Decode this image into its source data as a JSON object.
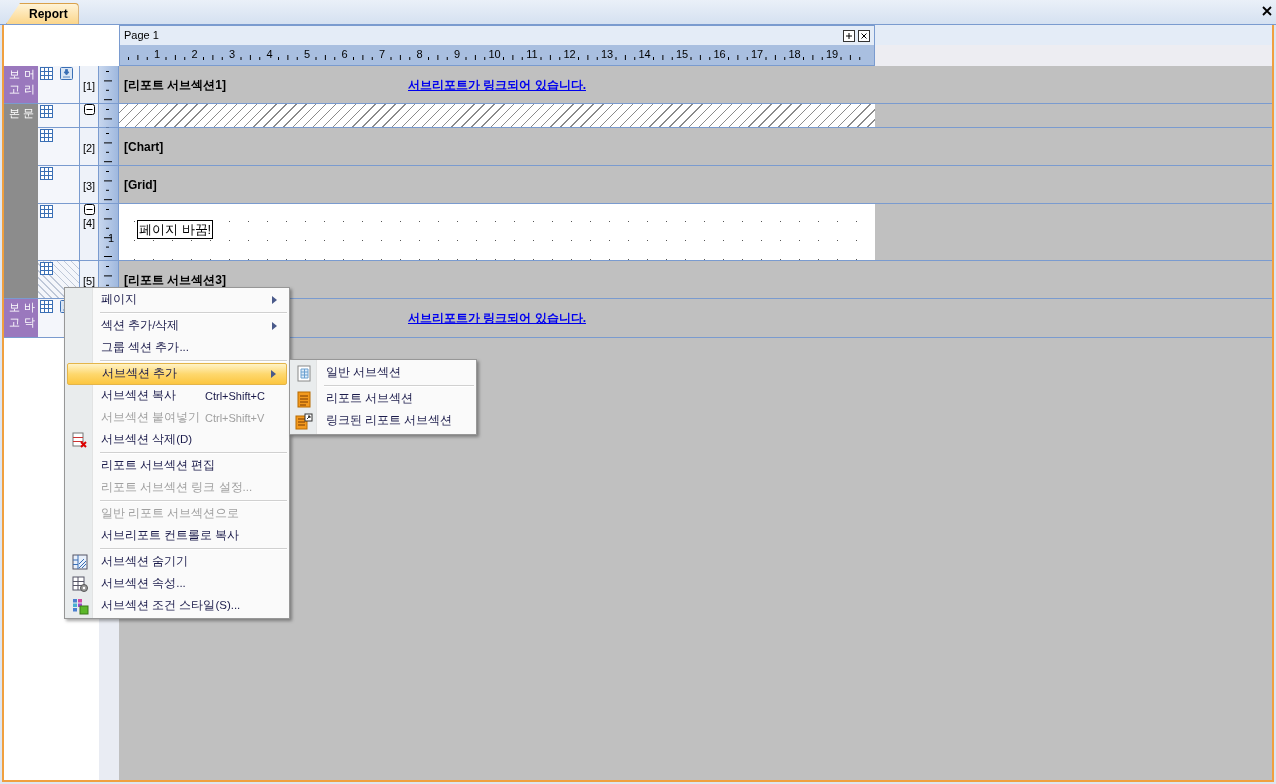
{
  "window": {
    "title": "Report"
  },
  "page": {
    "title": "Page 1",
    "ruler": [
      "1",
      "2",
      "3",
      "4",
      "5",
      "6",
      "7",
      "8",
      "9",
      "10",
      "11",
      "12",
      "13",
      "14",
      "15",
      "16",
      "17",
      "18",
      "19"
    ]
  },
  "bands": [
    {
      "kind": "vertical",
      "label_columns": [
        "보고",
        "머리"
      ],
      "rows": [
        {
          "kind": "gray",
          "number": "[1]",
          "text": "[리포트 서브섹션1]",
          "link": "서브리포트가 링크되어 있습니다.",
          "selected": false
        }
      ]
    },
    {
      "kind": "horizontal",
      "label": "본 문",
      "rows": [
        {
          "kind": "hatched",
          "expanded": true,
          "selected": false
        },
        {
          "kind": "gray",
          "number": "[2]",
          "text": "[Chart]",
          "selected": false
        },
        {
          "kind": "gray",
          "number": "[3]",
          "text": "[Grid]",
          "selected": false
        },
        {
          "kind": "breaker",
          "number": "[4]",
          "expanded": true,
          "ruler_label": "1",
          "box_text": "페이지 바꿈!",
          "selected": false
        },
        {
          "kind": "gray",
          "number": "[5]",
          "text": "[리포트 서브섹션3]",
          "selected": true
        }
      ]
    },
    {
      "kind": "vertical",
      "label_columns": [
        "보고",
        "바닥"
      ],
      "rows": [
        {
          "kind": "gray",
          "link": "서브리포트가 링크되어 있습니다.",
          "selected": false
        }
      ]
    }
  ],
  "context_menu": {
    "items": [
      {
        "kind": "item",
        "label": "페이지",
        "submenu": true,
        "disabled": false,
        "selected": false
      },
      {
        "kind": "separator"
      },
      {
        "kind": "item",
        "label": "섹션 추가/삭제",
        "submenu": true,
        "disabled": false,
        "selected": false
      },
      {
        "kind": "item",
        "label": "그룹 섹션 추가...",
        "submenu": false,
        "disabled": false,
        "selected": false
      },
      {
        "kind": "separator"
      },
      {
        "kind": "item",
        "label": "서브섹션 추가",
        "submenu": true,
        "disabled": false,
        "selected": true
      },
      {
        "kind": "item",
        "label": "서브섹션 복사",
        "shortcut": "Ctrl+Shift+C",
        "submenu": false,
        "disabled": false,
        "selected": false
      },
      {
        "kind": "item",
        "label": "서브섹션 붙여넣기",
        "shortcut": "Ctrl+Shift+V",
        "submenu": false,
        "disabled": true,
        "selected": false
      },
      {
        "kind": "item",
        "label": "서브섹션 삭제(D)",
        "submenu": false,
        "disabled": false,
        "selected": false
      },
      {
        "kind": "separator"
      },
      {
        "kind": "item",
        "label": "리포트 서브섹션 편집",
        "submenu": false,
        "disabled": false,
        "selected": false
      },
      {
        "kind": "item",
        "label": "리포트 서브섹션 링크 설정...",
        "submenu": false,
        "disabled": true,
        "selected": false
      },
      {
        "kind": "separator"
      },
      {
        "kind": "item",
        "label": "일반 리포트 서브섹션으로",
        "submenu": false,
        "disabled": true,
        "selected": false
      },
      {
        "kind": "item",
        "label": "서브리포트 컨트롤로 복사",
        "submenu": false,
        "disabled": false,
        "selected": false
      },
      {
        "kind": "separator"
      },
      {
        "kind": "item",
        "label": "서브섹션 숨기기",
        "submenu": false,
        "disabled": false,
        "selected": false
      },
      {
        "kind": "item",
        "label": "서브섹션 속성...",
        "submenu": false,
        "disabled": false,
        "selected": false
      },
      {
        "kind": "item",
        "label": "서브섹션 조건 스타일(S)...",
        "submenu": false,
        "disabled": false,
        "selected": false
      }
    ]
  },
  "submenu": {
    "items": [
      {
        "kind": "item",
        "label": "일반 서브섹션"
      },
      {
        "kind": "separator"
      },
      {
        "kind": "item",
        "label": "리포트 서브섹션"
      },
      {
        "kind": "item",
        "label": "링크된 리포트 서브섹션"
      }
    ]
  }
}
